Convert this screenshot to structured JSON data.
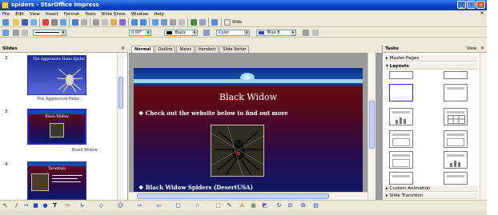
{
  "window": {
    "title": "spiders - StarOffice Impress"
  },
  "menubar": {
    "items": [
      "File",
      "Edit",
      "View",
      "Insert",
      "Format",
      "Tools",
      "Slide Show",
      "Window",
      "Help"
    ]
  },
  "toolbar_line": {
    "line_width": "0.00\"",
    "line_color": "Black",
    "area_style": "Color",
    "area_color": "Blue 8",
    "slide_label": "Slide"
  },
  "slides_panel": {
    "title": "Slides",
    "slides": [
      {
        "number": "2",
        "caption": "The Aggressive Hobo",
        "thumb_title": "The Aggressive Hobo Spider"
      },
      {
        "number": "3",
        "caption": "Black Widow",
        "thumb_title": "Black Widow"
      },
      {
        "number": "4",
        "caption": "",
        "thumb_title": "Tarantula"
      }
    ]
  },
  "view_tabs": [
    "Normal",
    "Outline",
    "Notes",
    "Handout",
    "Slide Sorter"
  ],
  "current_slide": {
    "title": "Black Widow",
    "bullets": [
      "Check out the website below to find out more",
      "Black Widow Spiders (DesertUSA)"
    ]
  },
  "tasks_panel": {
    "title": "Tasks",
    "view_label": "View",
    "sections": [
      "Master Pages",
      "Layouts",
      "Custom Animation",
      "Slide Transition"
    ]
  },
  "colors": {
    "titlebar": "#0a3fc4",
    "slide_top": "#6d0c0c",
    "slide_bottom": "#0c1b6e",
    "selection": "#2a2ad0"
  }
}
